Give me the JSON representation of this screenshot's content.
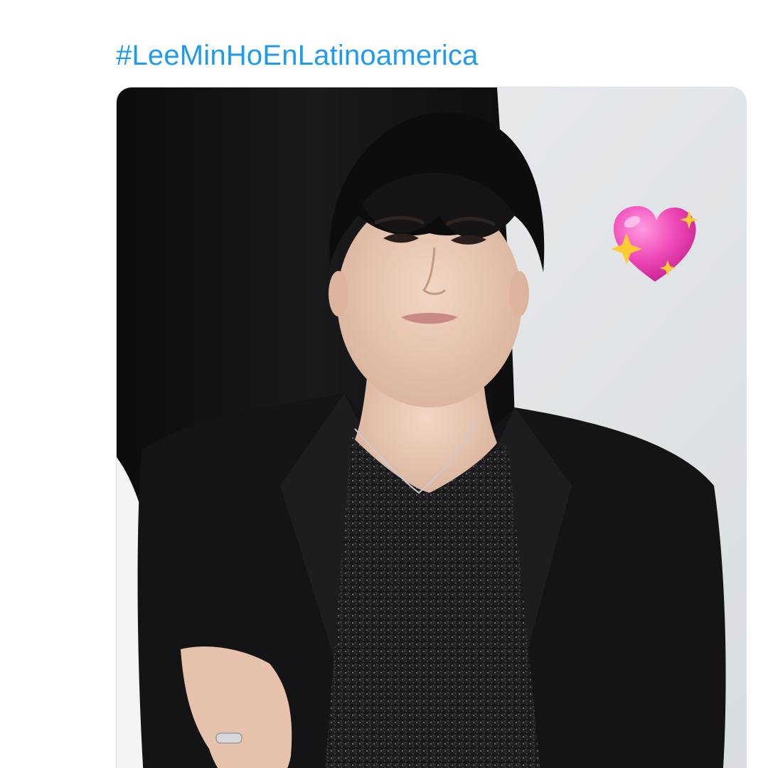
{
  "tweet": {
    "hashtag": "#LeeMinHoEnLatinoamerica",
    "link_color": "#1d9bf0"
  },
  "media": {
    "type": "photo",
    "overlay_emoji": "sparkling-heart",
    "colors": {
      "backdrop_dark": "#111112",
      "backdrop_light": "#e4e6e9",
      "jacket": "#141416",
      "heart": "#f04ab8",
      "sparkle": "#ffcc33"
    }
  }
}
